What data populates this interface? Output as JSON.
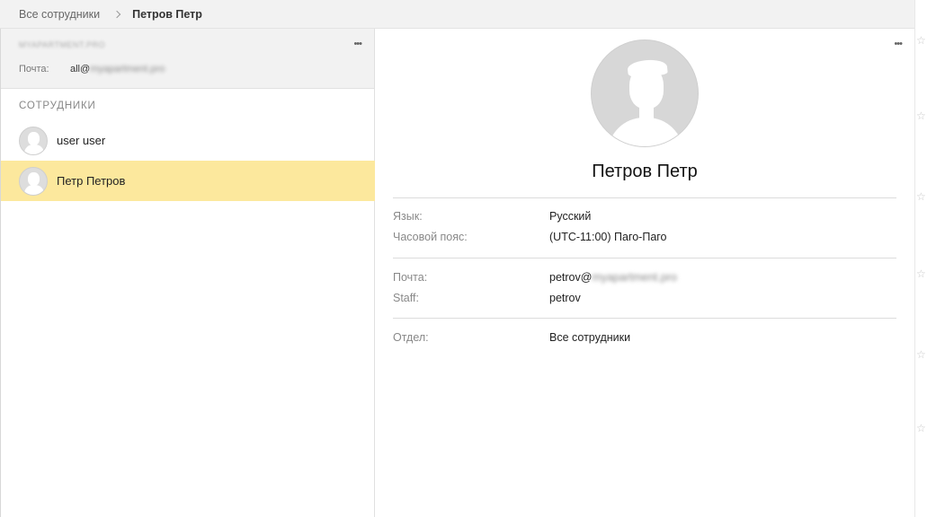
{
  "breadcrumb": {
    "parent": "Все сотрудники",
    "current": "Петров Петр"
  },
  "org": {
    "domain": "MYAPARTMENT.PRO",
    "mail_label": "Почта:",
    "mail_local": "all@",
    "mail_domain": "myapartment.pro",
    "menu_icon": "more-dots-icon"
  },
  "employees_section": {
    "title": "Сотрудники",
    "items": [
      {
        "name": "user user",
        "selected": false
      },
      {
        "name": "Петр Петров",
        "selected": true
      }
    ]
  },
  "profile": {
    "full_name": "Петров Петр",
    "menu_icon": "more-dots-icon",
    "groups": [
      {
        "rows": [
          {
            "label": "Язык:",
            "value": "Русский"
          },
          {
            "label": "Часовой пояс:",
            "value": "(UTC-11:00) Паго-Паго"
          }
        ]
      },
      {
        "rows": [
          {
            "label": "Почта:",
            "value_local": "petrov@",
            "value_domain": "myapartment.pro"
          },
          {
            "label": "Staff:",
            "value": "petrov"
          }
        ]
      },
      {
        "rows": [
          {
            "label": "Отдел:",
            "value": "Все сотрудники"
          }
        ]
      }
    ]
  },
  "colors": {
    "selected_row": "#fce89d",
    "header_bg": "#f2f2f2"
  },
  "edge_icons": [
    "star-icon",
    "star-icon",
    "star-icon",
    "star-icon",
    "star-icon",
    "star-icon"
  ]
}
